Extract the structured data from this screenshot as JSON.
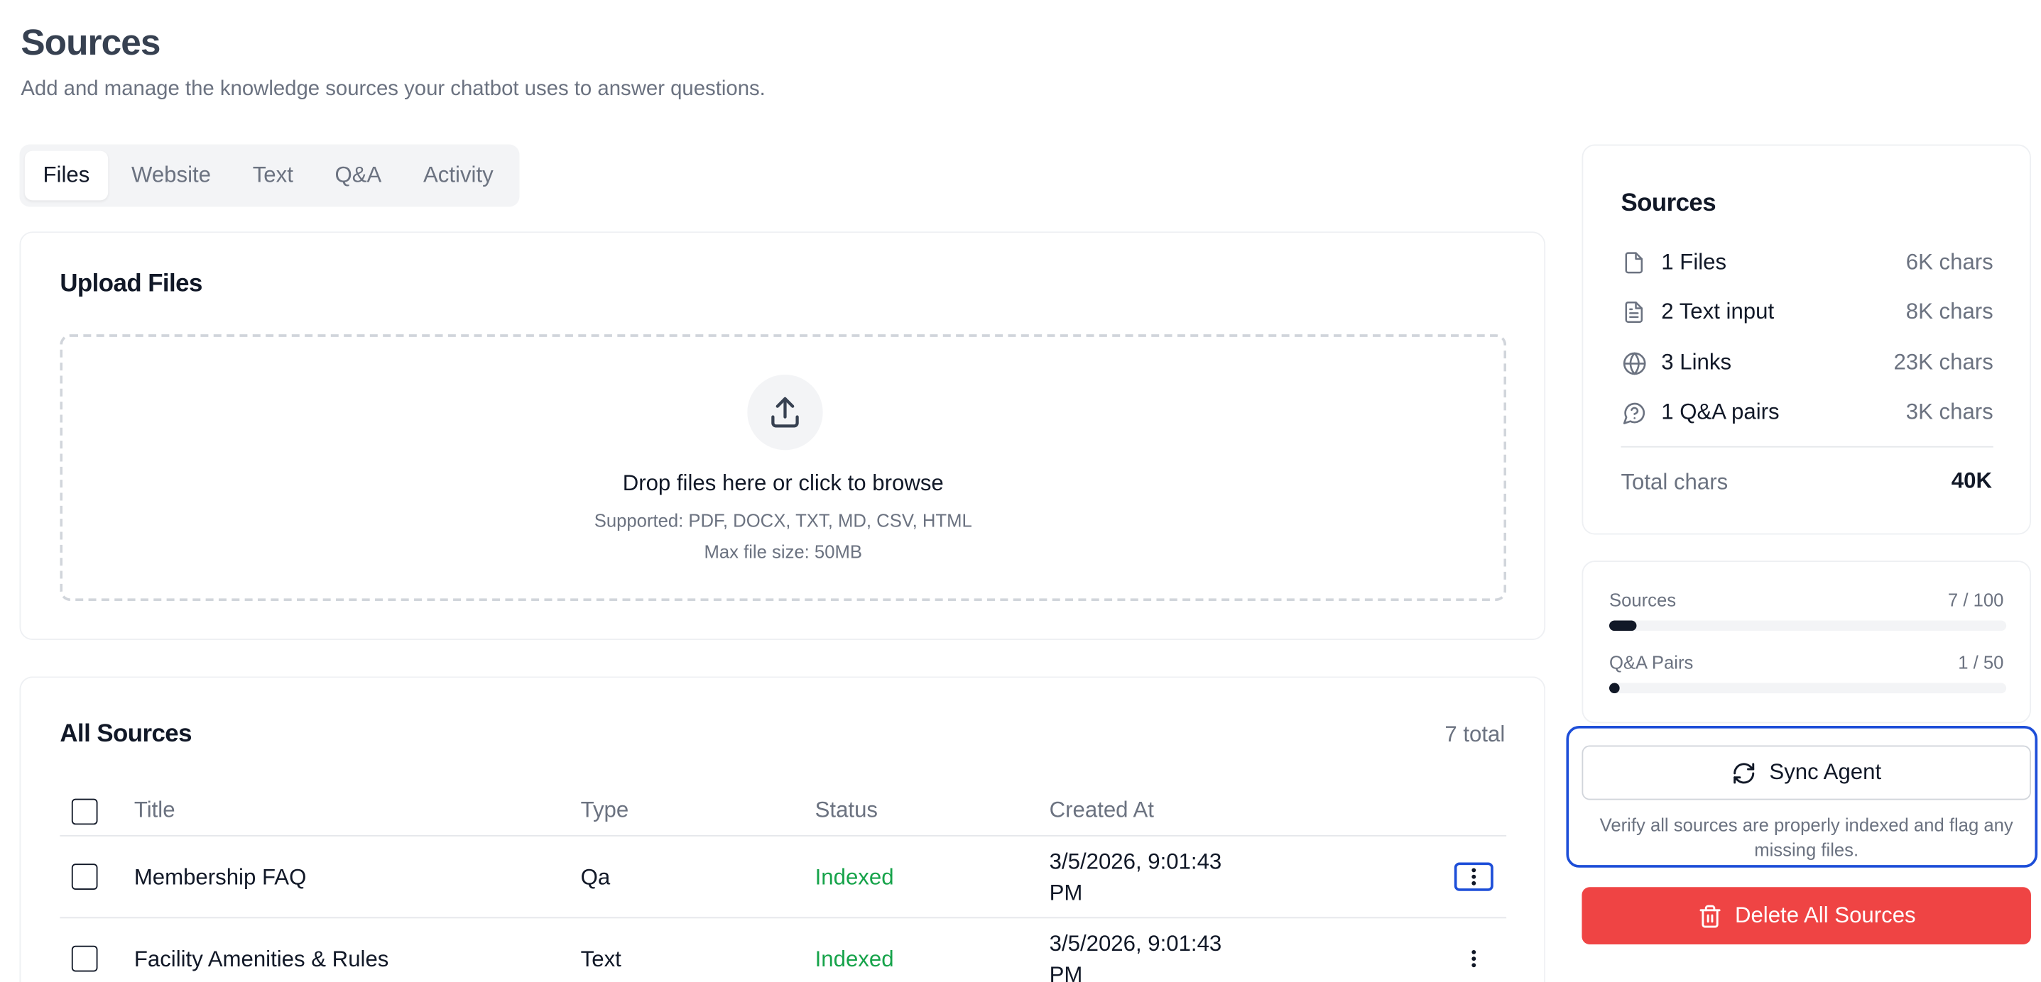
{
  "header": {
    "title": "Sources",
    "subtitle": "Add and manage the knowledge sources your chatbot uses to answer questions."
  },
  "tabs": [
    {
      "label": "Files",
      "active": true
    },
    {
      "label": "Website",
      "active": false
    },
    {
      "label": "Text",
      "active": false
    },
    {
      "label": "Q&A",
      "active": false
    },
    {
      "label": "Activity",
      "active": false
    }
  ],
  "upload": {
    "title": "Upload Files",
    "drop_text": "Drop files here or click to browse",
    "supported": "Supported: PDF, DOCX, TXT, MD, CSV, HTML",
    "max_size": "Max file size: 50MB",
    "icon": "upload-icon"
  },
  "all_sources": {
    "title": "All Sources",
    "total": "7 total",
    "columns": {
      "title": "Title",
      "type": "Type",
      "status": "Status",
      "created": "Created At"
    },
    "rows": [
      {
        "title": "Membership FAQ",
        "type": "Qa",
        "status": "Indexed",
        "created_1": "3/5/2026, 9:01:43",
        "created_2": "PM"
      },
      {
        "title": "Facility Amenities & Rules",
        "type": "Text",
        "status": "Indexed",
        "created_1": "3/5/2026, 9:01:43",
        "created_2": "PM"
      }
    ]
  },
  "summary": {
    "title": "Sources",
    "items": [
      {
        "label": "1 Files",
        "value": "6K chars",
        "icon": "file-icon"
      },
      {
        "label": "2 Text input",
        "value": "8K chars",
        "icon": "file-text-icon"
      },
      {
        "label": "3 Links",
        "value": "23K chars",
        "icon": "globe-icon"
      },
      {
        "label": "1 Q&A pairs",
        "value": "3K chars",
        "icon": "help-circle-icon"
      }
    ],
    "total_label": "Total chars",
    "total_value": "40K"
  },
  "usage": {
    "sources": {
      "label": "Sources",
      "value": "7 / 100",
      "fraction": 0.07
    },
    "qa": {
      "label": "Q&A Pairs",
      "value": "1 / 50",
      "fraction": 0.02
    }
  },
  "actions": {
    "sync_label": "Sync Agent",
    "sync_note": "Verify all sources are properly indexed and flag any missing files.",
    "delete_label": "Delete All Sources"
  },
  "colors": {
    "accent_focus": "#1d4ed8",
    "indexed": "#16a34a",
    "danger": "#ef4444"
  }
}
